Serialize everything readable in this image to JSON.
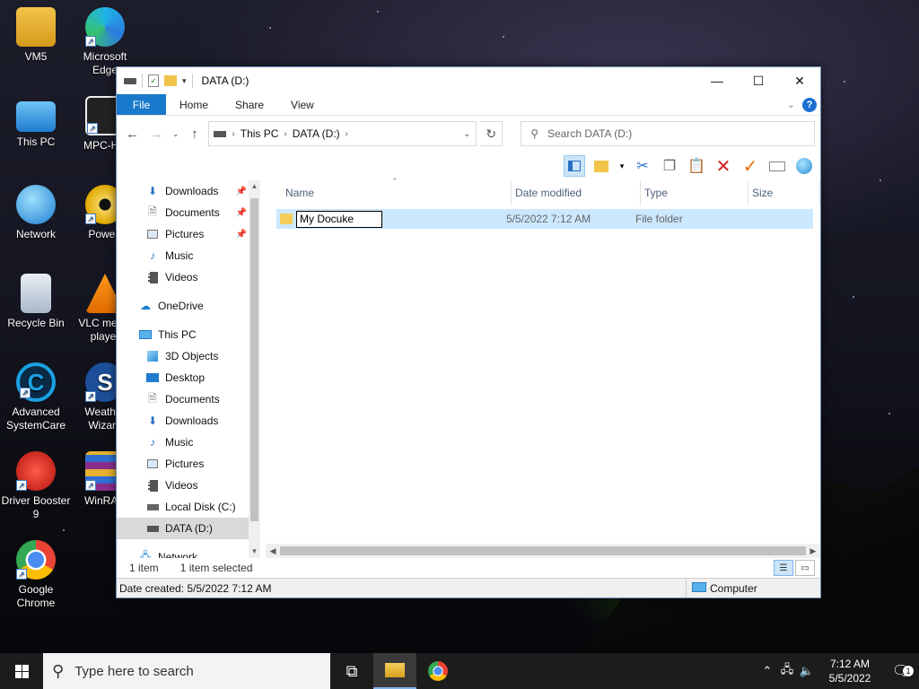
{
  "desktop": {
    "icons": [
      {
        "label": "VM5"
      },
      {
        "label": "Microsoft Edge"
      },
      {
        "label": "This PC"
      },
      {
        "label": "MPC-HC"
      },
      {
        "label": "Network"
      },
      {
        "label": "PowerI"
      },
      {
        "label": "Recycle Bin"
      },
      {
        "label": "VLC media player"
      },
      {
        "label": "Advanced SystemCare"
      },
      {
        "label": "Weather Wizard"
      },
      {
        "label": "Driver Booster 9"
      },
      {
        "label": "WinRAR"
      },
      {
        "label": "Google Chrome"
      }
    ]
  },
  "window": {
    "title": "DATA (D:)",
    "tabs": {
      "file": "File",
      "home": "Home",
      "share": "Share",
      "view": "View"
    },
    "help": "?",
    "address": {
      "crumb1": "This PC",
      "crumb2": "DATA (D:)"
    },
    "search": {
      "placeholder": "Search DATA (D:)"
    },
    "nav": {
      "downloads_q": "Downloads",
      "documents_q": "Documents",
      "pictures_q": "Pictures",
      "music_q": "Music",
      "videos_q": "Videos",
      "onedrive": "OneDrive",
      "thispc": "This PC",
      "objects3d": "3D Objects",
      "desktop": "Desktop",
      "documents": "Documents",
      "downloads": "Downloads",
      "music": "Music",
      "pictures": "Pictures",
      "videos": "Videos",
      "localdisk": "Local Disk (C:)",
      "datad": "DATA (D:)",
      "network": "Network"
    },
    "columns": {
      "name": "Name",
      "date": "Date modified",
      "type": "Type",
      "size": "Size"
    },
    "file": {
      "name_value": "My Docuke",
      "date": "5/5/2022 7:12 AM",
      "type": "File folder"
    },
    "status": {
      "count": "1 item",
      "selected": "1 item selected",
      "created": "Date created: 5/5/2022 7:12 AM",
      "location": "Computer"
    }
  },
  "taskbar": {
    "search_placeholder": "Type here to search",
    "time": "7:12 AM",
    "date": "5/5/2022",
    "notif_count": "1"
  },
  "colors": {
    "accent": "#1979ca",
    "selection": "#cce8ff",
    "taskbar": "#1c1c1c"
  }
}
